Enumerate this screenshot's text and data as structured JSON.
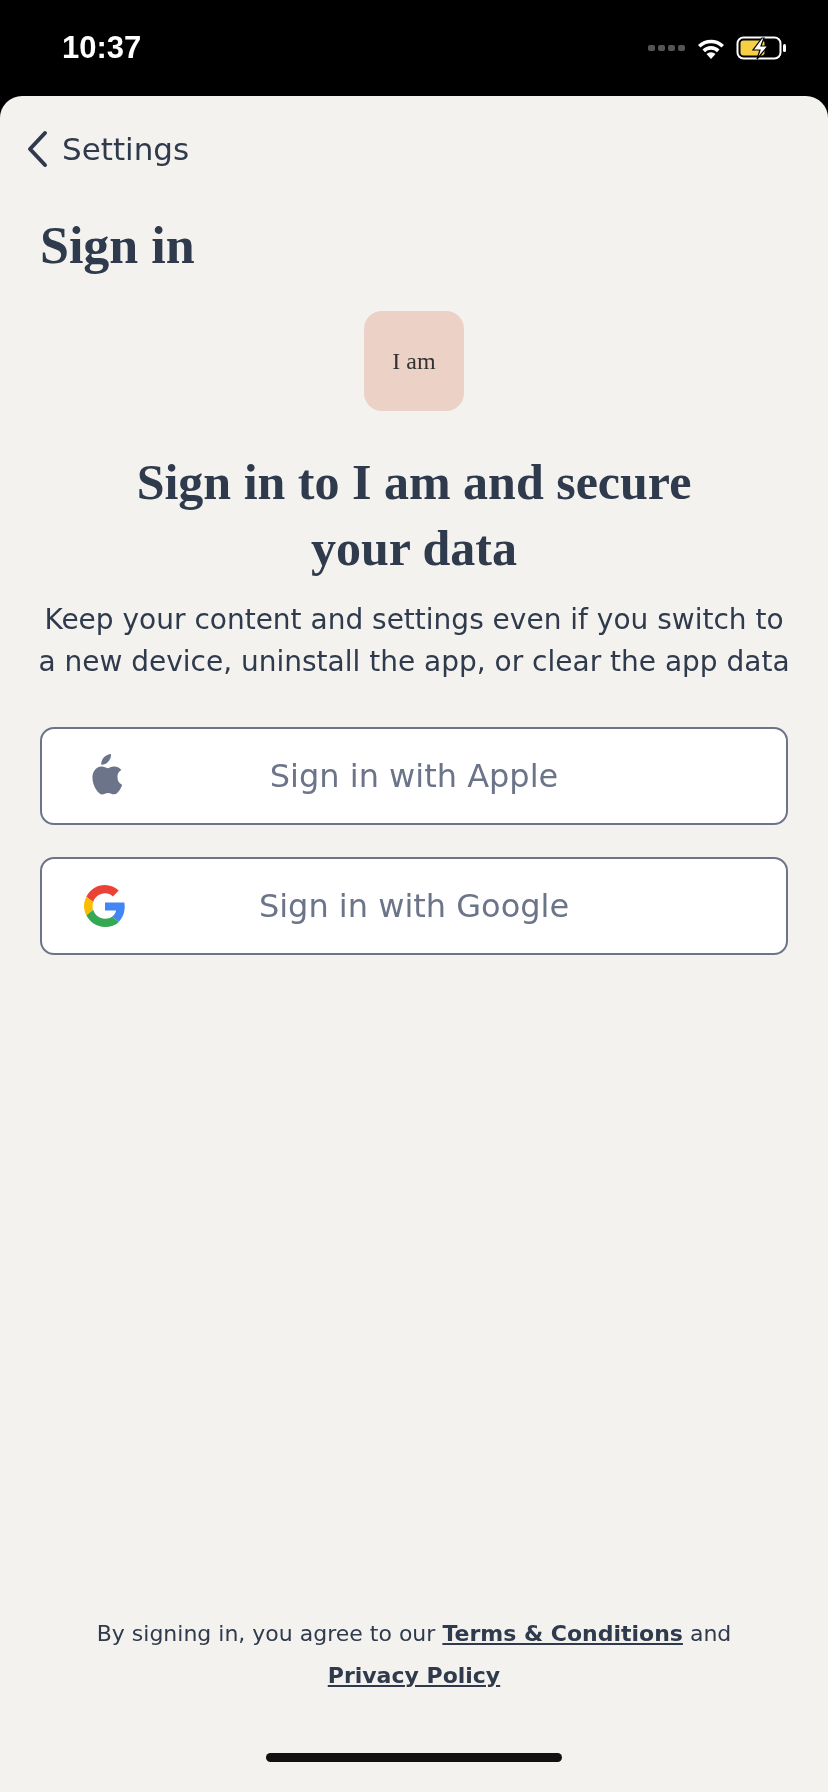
{
  "status_bar": {
    "time": "10:37"
  },
  "nav": {
    "back_label": "Settings"
  },
  "title": "Sign in",
  "logo": {
    "text": "I am"
  },
  "headline": "Sign in to I am and secure your data",
  "description": "Keep your content and settings even if you switch to a new device, uninstall the app, or clear the app data",
  "buttons": [
    {
      "label": "Sign in with Apple",
      "kind": "apple"
    },
    {
      "label": "Sign in with Google",
      "kind": "google"
    }
  ],
  "footer": [
    {
      "kind": "text",
      "text": "By signing in, you agree to our"
    },
    {
      "kind": "link",
      "text": "Terms & Conditions"
    },
    {
      "kind": "text",
      "text": "and"
    },
    {
      "kind": "link",
      "text": "Privacy Policy"
    }
  ]
}
